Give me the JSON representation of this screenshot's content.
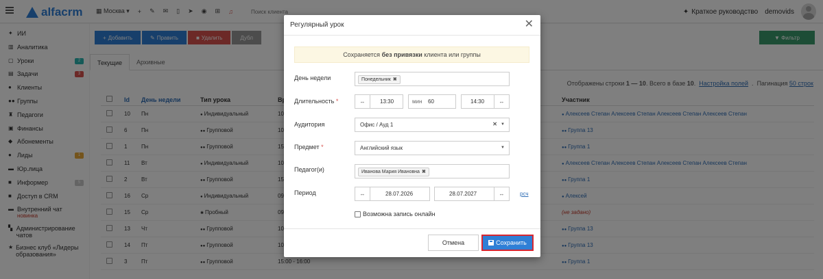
{
  "app": {
    "logo_text": "alfacrm",
    "branch": "Москва",
    "search_placeholder": "Поиск клиента",
    "guide_label": "Краткое руководство",
    "username": "demovids"
  },
  "sidebar": {
    "items": [
      {
        "label": "ИИ",
        "icon": "sparkle-icon"
      },
      {
        "label": "Аналитика",
        "icon": "chart-icon"
      },
      {
        "label": "Уроки",
        "icon": "calendar-icon",
        "badge": "2",
        "badge_color": "#2bb5b0"
      },
      {
        "label": "Задачи",
        "icon": "tasks-icon",
        "badge": "3",
        "badge_color": "#d9534f"
      },
      {
        "label": "Клиенты",
        "icon": "user-icon"
      },
      {
        "label": "Группы",
        "icon": "users-icon"
      },
      {
        "label": "Педагоги",
        "icon": "teacher-icon"
      },
      {
        "label": "Финансы",
        "icon": "money-icon"
      },
      {
        "label": "Абонементы",
        "icon": "tag-icon"
      },
      {
        "label": "Лиды",
        "icon": "lead-icon",
        "badge": "1",
        "badge_color": "#e8a838"
      },
      {
        "label": "Юр.лица",
        "icon": "briefcase-icon"
      },
      {
        "label": "Информер",
        "icon": "informer-icon",
        "badge": "5",
        "badge_color": "#c9c9c9"
      },
      {
        "label": "Доступ в CRM",
        "icon": "lock-icon"
      },
      {
        "label": "Внутренний чат",
        "sub": "новинка",
        "icon": "chat-icon"
      },
      {
        "label": "Администрирование чатов",
        "icon": "chat-admin-icon"
      },
      {
        "label": "Бизнес клуб «Лидеры образования»",
        "icon": "star-icon"
      }
    ]
  },
  "toolbar": {
    "add": "Добавить",
    "edit": "Править",
    "delete": "Удалить",
    "more": "Дубл",
    "filter": "Фильтр"
  },
  "tabs": {
    "current": "Текущие",
    "archive": "Архивные"
  },
  "table": {
    "meta_shown": "Отображены строки",
    "meta_range": "1 — 10",
    "meta_total": ". Всего в базе",
    "meta_count": "10",
    "settings_link": "Настройка полей",
    "pagination_label": "Пагинация",
    "pagination_link": "50 строк",
    "headers": {
      "id": "Id",
      "day": "День недели",
      "type": "Тип урока",
      "time": "Вр",
      "participant": "Участник"
    },
    "rows": [
      {
        "id": "10",
        "day": "Пн",
        "type": "Индивидуальный",
        "type_icon": "user-icon",
        "time": "10",
        "participant": "Алексеев Степан Алексеев Степан Алексеев Степан Алексеев Степан",
        "p_icon": "user-icon"
      },
      {
        "id": "6",
        "day": "Пн",
        "type": "Групповой",
        "type_icon": "users-icon",
        "time": "10",
        "participant": "Группа 13",
        "p_icon": "users-icon"
      },
      {
        "id": "1",
        "day": "Пн",
        "type": "Групповой",
        "type_icon": "users-icon",
        "time": "15",
        "participant": "Группа 1",
        "p_icon": "users-icon"
      },
      {
        "id": "11",
        "day": "Вт",
        "type": "Индивидуальный",
        "type_icon": "user-icon",
        "time": "10",
        "participant": "Алексеев Степан Алексеев Степан Алексеев Степан Алексеев Степан",
        "p_icon": "user-icon"
      },
      {
        "id": "2",
        "day": "Вт",
        "type": "Групповой",
        "type_icon": "users-icon",
        "time": "15",
        "participant": "Группа 1",
        "p_icon": "users-icon"
      },
      {
        "id": "16",
        "day": "Ср",
        "type": "Индивидуальный",
        "type_icon": "user-icon",
        "time": "09",
        "participant": "Алексей",
        "p_icon": "user-icon"
      },
      {
        "id": "15",
        "day": "Ср",
        "type": "Пробный",
        "type_icon": "trial-icon",
        "time": "09",
        "participant": "(не задано)",
        "p_icon": ""
      },
      {
        "id": "13",
        "day": "Чт",
        "type": "Групповой",
        "type_icon": "users-icon",
        "time": "10",
        "participant": "Группа 13",
        "p_icon": "users-icon"
      },
      {
        "id": "14",
        "day": "Пт",
        "type": "Групповой",
        "type_icon": "users-icon",
        "time": "10",
        "participant": "Группа 13",
        "p_icon": "users-icon"
      },
      {
        "id": "3",
        "day": "Пт",
        "type": "Групповой",
        "type_icon": "users-icon",
        "time": "15:00 - 16:00",
        "participant": "Группа 1",
        "p_icon": "users-icon"
      }
    ]
  },
  "modal": {
    "title": "Регулярный урок",
    "notice_pre": "Сохраняется",
    "notice_bold": "без привязки",
    "notice_post": "клиента или группы",
    "labels": {
      "weekday": "День недели",
      "duration": "Длительность",
      "room": "Аудитория",
      "subject": "Предмет",
      "teacher": "Педагог(и)",
      "period": "Период"
    },
    "weekday_chip": "Понедельник",
    "time_start": "13:30",
    "min_label": "мин",
    "minutes": "60",
    "time_end": "14:30",
    "room_value": "Офис / Ауд 1",
    "subject_value": "Английский язык",
    "teacher_chip": "Иванова Мария Ивановна",
    "date_start": "28.07.2026",
    "date_end": "28.07.2027",
    "rsch_link": "рсч",
    "online_label": "Возможна запись онлайн",
    "cancel": "Отмена",
    "save": "Сохранить"
  }
}
